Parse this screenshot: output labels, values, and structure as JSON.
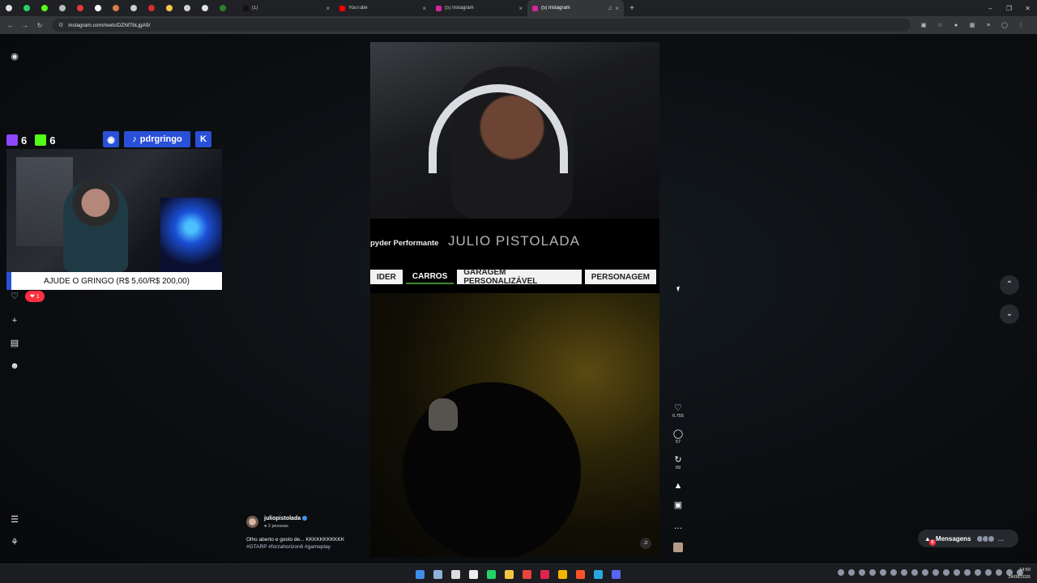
{
  "browser": {
    "pinned_tabs": [
      {
        "icon": "chrome-ui-icon",
        "color": "#e0e0e0"
      },
      {
        "icon": "whatsapp-icon",
        "color": "#25d366"
      },
      {
        "icon": "kick-icon",
        "color": "#53fc18"
      },
      {
        "icon": "tools-icon",
        "color": "#bbbbbb"
      },
      {
        "icon": "record-icon",
        "color": "#e53935"
      },
      {
        "icon": "notion-icon",
        "color": "#ffffff"
      },
      {
        "icon": "game-icon",
        "color": "#d97b4a"
      },
      {
        "icon": "settings-icon",
        "color": "#cccccc"
      },
      {
        "icon": "red-app-icon",
        "color": "#d32f2f"
      },
      {
        "icon": "docs-icon",
        "color": "#f2c94c"
      },
      {
        "icon": "globe-icon",
        "color": "#cfcfcf"
      },
      {
        "icon": "download-icon",
        "color": "#e0e0e0"
      },
      {
        "icon": "green-app-icon",
        "color": "#2e7d32"
      }
    ],
    "tabs": [
      {
        "title": "(1)",
        "favicon_color": "#111111",
        "active": false,
        "audio": false
      },
      {
        "title": "YouTube",
        "favicon_color": "#ff0000",
        "active": false,
        "audio": false
      },
      {
        "title": "(5) Instagram",
        "favicon_color": "#d6249f",
        "active": false,
        "audio": false
      },
      {
        "title": "(5) Instagram",
        "favicon_color": "#d6249f",
        "active": true,
        "audio": true
      }
    ],
    "url": "instagram.com/reels/DZNf7bLjgA9/"
  },
  "overlay": {
    "twitch_count": "6",
    "kick_count": "6",
    "tiktok_handle": "pdrgringo",
    "donate_text": "AJUDE O GRINGO (R$ 5,60/R$ 200,00)"
  },
  "notification": {
    "count": "1"
  },
  "reel": {
    "car_name_partial": "pyder Performante",
    "game_title": "JULIO PISTOLADA",
    "menu_items": [
      {
        "label": "IDER",
        "selected": false
      },
      {
        "label": "CARROS",
        "selected": true
      },
      {
        "label": "GARAGEM PERSONALIZÁVEL",
        "selected": false
      },
      {
        "label": "PERSONAGEM",
        "selected": false
      }
    ]
  },
  "actions": {
    "likes": "6.755",
    "comments": "57",
    "reposts": "69"
  },
  "caption": {
    "username": "juliopistolada",
    "people": "2 pessoas",
    "text": "Olho aberto e gosto de... KKKKKKKKKKK",
    "hashtags": "#GTARP #forzahorizon6 #gameplay"
  },
  "messages": {
    "label": "Mensagens",
    "badge": "6"
  },
  "taskbar": {
    "apps": [
      {
        "icon": "windows-start-icon",
        "color": "#3d8ee6"
      },
      {
        "icon": "copilot-icon",
        "color": "#8fb0d8"
      },
      {
        "icon": "notes-icon",
        "color": "#dddddd"
      },
      {
        "icon": "media-icon",
        "color": "#eeeeee"
      },
      {
        "icon": "whatsapp-icon",
        "color": "#25d366"
      },
      {
        "icon": "folder-icon",
        "color": "#f5c542"
      },
      {
        "icon": "chrome-icon",
        "color": "#e8453c"
      },
      {
        "icon": "opera-icon",
        "color": "#e0234e"
      },
      {
        "icon": "chrome-active-icon",
        "color": "#f4b400"
      },
      {
        "icon": "brave-icon",
        "color": "#fb542b"
      },
      {
        "icon": "telegram-icon",
        "color": "#2aa7e0"
      },
      {
        "icon": "discord-icon",
        "color": "#5865f2"
      }
    ],
    "time": "14:50",
    "date": "24/08/2026"
  }
}
